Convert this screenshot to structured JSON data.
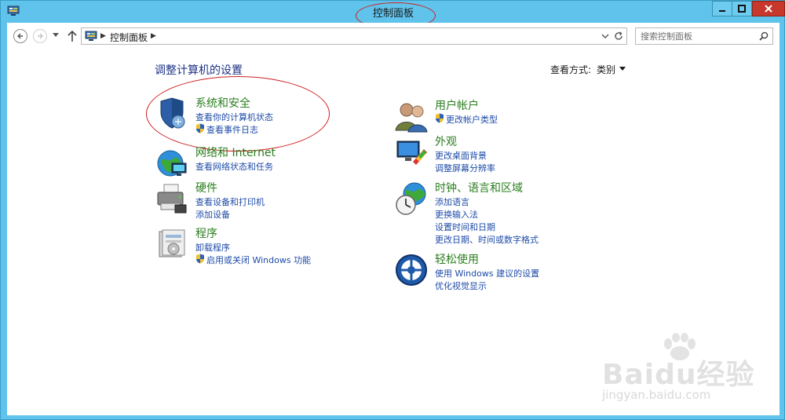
{
  "window": {
    "title": "控制面板"
  },
  "titlebar": {
    "min_label": "minimize",
    "max_label": "maximize",
    "close_label": "close"
  },
  "address": {
    "crumb": "控制面板"
  },
  "search": {
    "placeholder": "搜索控制面板"
  },
  "main": {
    "heading": "调整计算机的设置",
    "view_by_label": "查看方式:",
    "view_by_value": "类别"
  },
  "left_categories": [
    {
      "title": "系统和安全",
      "links": [
        "查看你的计算机状态",
        "查看事件日志"
      ],
      "icon": "shield-icon"
    },
    {
      "title": "网络和 Internet",
      "links": [
        "查看网络状态和任务"
      ],
      "icon": "network-globe-icon"
    },
    {
      "title": "硬件",
      "links": [
        "查看设备和打印机",
        "添加设备"
      ],
      "icon": "printer-icon"
    },
    {
      "title": "程序",
      "links": [
        "卸载程序",
        "启用或关闭 Windows 功能"
      ],
      "icon": "programs-icon"
    }
  ],
  "right_categories": [
    {
      "title": "用户帐户",
      "links": [
        "更改帐户类型"
      ],
      "icon": "users-icon"
    },
    {
      "title": "外观",
      "links": [
        "更改桌面背景",
        "调整屏幕分辨率"
      ],
      "icon": "display-icon"
    },
    {
      "title": "时钟、语言和区域",
      "links": [
        "添加语言",
        "更换输入法",
        "设置时间和日期",
        "更改日期、时间或数字格式"
      ],
      "icon": "clock-globe-icon"
    },
    {
      "title": "轻松使用",
      "links": [
        "使用 Windows 建议的设置",
        "优化视觉显示"
      ],
      "icon": "ease-of-access-icon"
    }
  ],
  "watermark": {
    "brand": "Baidu经验",
    "url": "jingyan.baidu.com"
  },
  "colors": {
    "titlebar": "#5fc3ec",
    "category_title": "#2a7d1e",
    "link": "#1e4ba8",
    "heading": "#1e3287",
    "close": "#c7372b"
  }
}
